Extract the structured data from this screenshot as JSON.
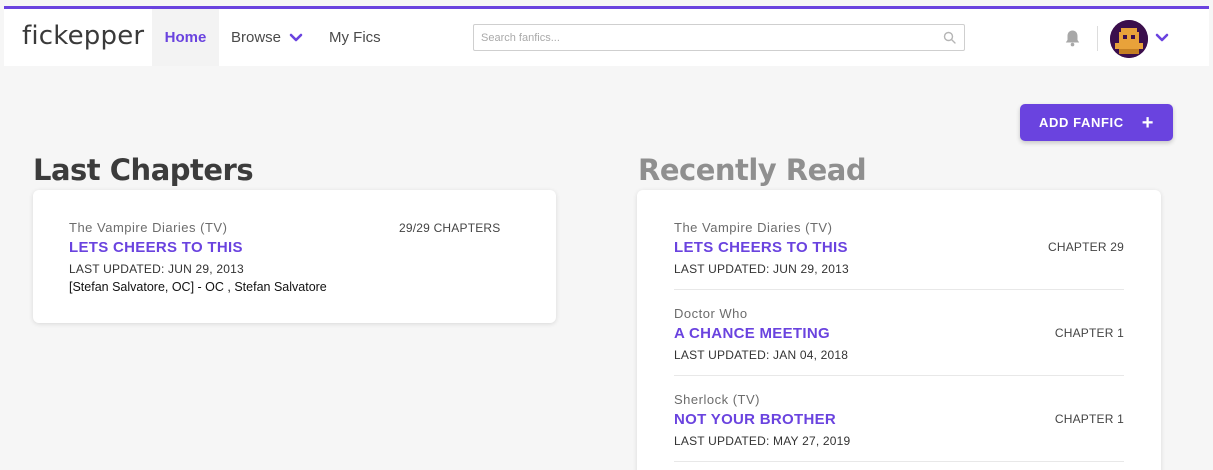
{
  "nav": {
    "logo": "fickepper",
    "home": "Home",
    "browse": "Browse",
    "myfics": "My Fics",
    "search_placeholder": "Search fanfics...",
    "accent": "#6a43df"
  },
  "actions": {
    "add_fanfic": "ADD FANFIC",
    "add_icon": "+"
  },
  "last_chapters": {
    "heading": "Last Chapters",
    "items": [
      {
        "fandom": "The Vampire Diaries (TV)",
        "title": "LETS CHEERS TO THIS",
        "updated": "LAST UPDATED: JUN 29, 2013",
        "chapters": "29/29 CHAPTERS",
        "characters": "[Stefan Salvatore, OC] - OC , Stefan Salvatore"
      }
    ]
  },
  "recently_read": {
    "heading": "Recently Read",
    "items": [
      {
        "fandom": "The Vampire Diaries (TV)",
        "title": "LETS CHEERS TO THIS",
        "updated": "LAST UPDATED: JUN 29, 2013",
        "chapter": "CHAPTER 29"
      },
      {
        "fandom": "Doctor Who",
        "title": "A CHANCE MEETING",
        "updated": "LAST UPDATED: JAN 04, 2018",
        "chapter": "CHAPTER 1"
      },
      {
        "fandom": "Sherlock (TV)",
        "title": "NOT YOUR BROTHER",
        "updated": "LAST UPDATED: MAY 27, 2019",
        "chapter": "CHAPTER 1"
      }
    ]
  }
}
